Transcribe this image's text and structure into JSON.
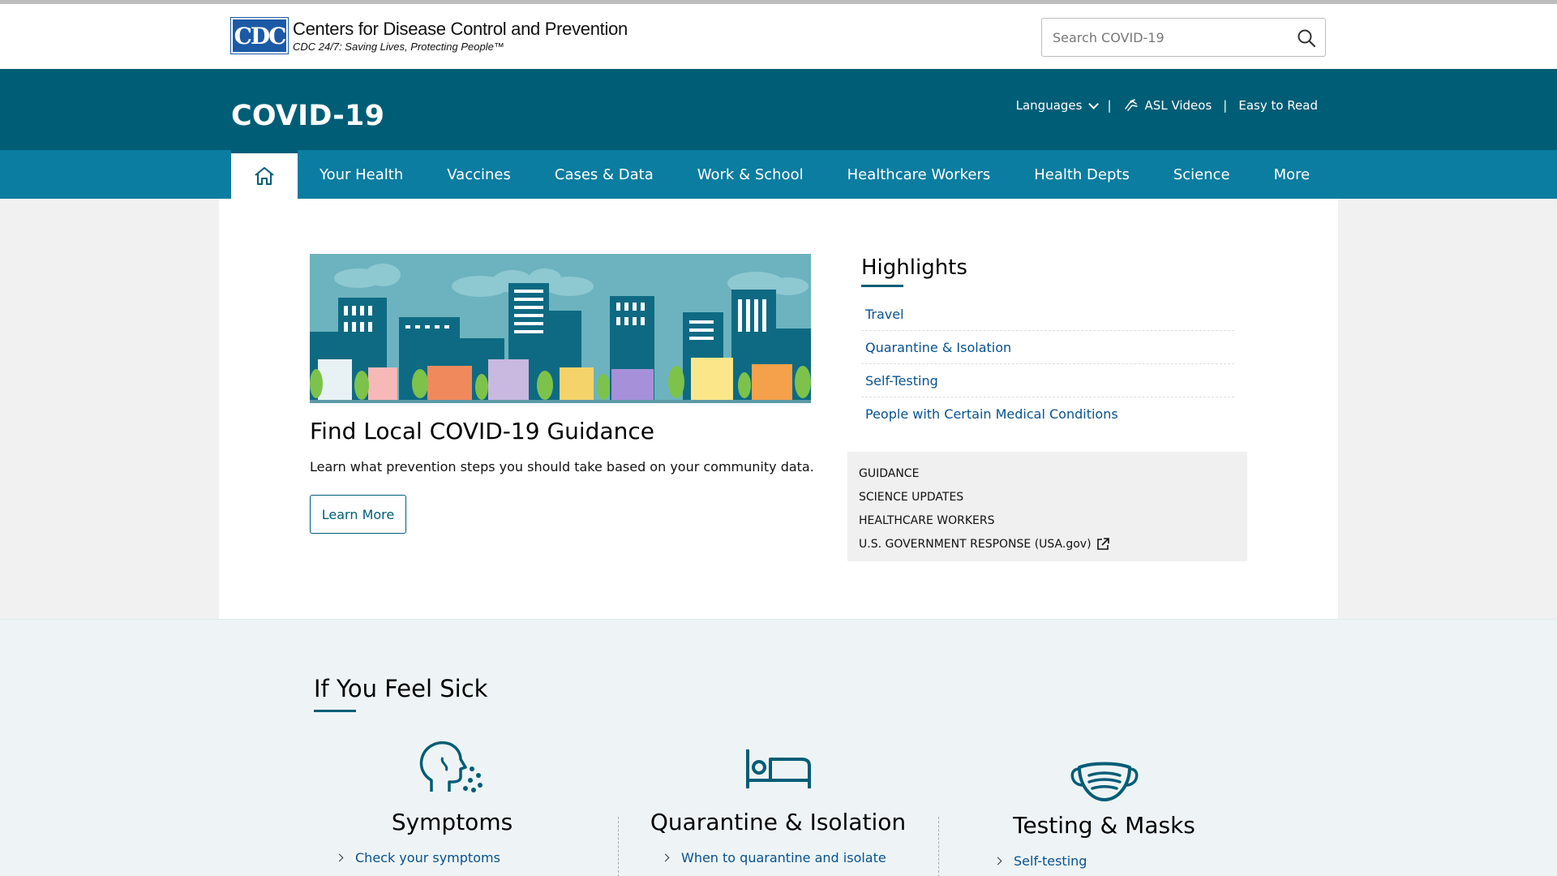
{
  "header": {
    "logo_mark": "CDC",
    "org_name": "Centers for Disease Control and Prevention",
    "tagline": "CDC 24/7: Saving Lives, Protecting People™",
    "search_placeholder": "Search COVID-19"
  },
  "titlebar": {
    "title": "COVID-19",
    "languages": "Languages",
    "asl": "ASL Videos",
    "easy": "Easy to Read",
    "sep": "|"
  },
  "nav": {
    "items": [
      "Your Health",
      "Vaccines",
      "Cases & Data",
      "Work & School",
      "Healthcare Workers",
      "Health Depts",
      "Science",
      "More"
    ]
  },
  "hero": {
    "title": "Find Local COVID-19 Guidance",
    "description": "Learn what prevention steps you should take based on your community data.",
    "button": "Learn More"
  },
  "highlights": {
    "title": "Highlights",
    "items": [
      "Travel",
      "Quarantine & Isolation",
      "Self-Testing",
      "People with Certain Medical Conditions"
    ]
  },
  "quick_links": [
    "GUIDANCE",
    "SCIENCE UPDATES",
    "HEALTHCARE WORKERS",
    "U.S. GOVERNMENT RESPONSE (USA.gov)"
  ],
  "sick": {
    "title": "If You Feel Sick",
    "columns": [
      {
        "title": "Symptoms",
        "link": "Check your symptoms"
      },
      {
        "title": "Quarantine & Isolation",
        "link": "When to quarantine and isolate"
      },
      {
        "title": "Testing & Masks",
        "link": "Self-testing"
      }
    ]
  },
  "colors": {
    "teal_dark": "#005d76",
    "teal_nav": "#0b7da0",
    "link": "#075290"
  }
}
